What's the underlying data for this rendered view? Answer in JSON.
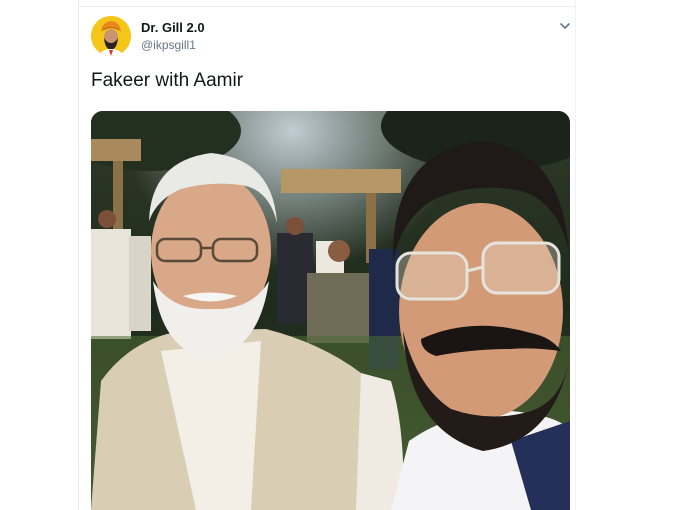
{
  "tweet": {
    "display_name": "Dr. Gill 2.0",
    "handle": "@ikpsgill1",
    "text": "Fakeer with Aamir",
    "avatar_icon": "turbaned-man-avatar",
    "menu_icon": "chevron-down-icon",
    "media_description_icon": "selfie-photo"
  },
  "colors": {
    "name": "#14171a",
    "handle": "#657786",
    "avatar_bg": "#f5c518",
    "border": "#e6ecf0"
  }
}
